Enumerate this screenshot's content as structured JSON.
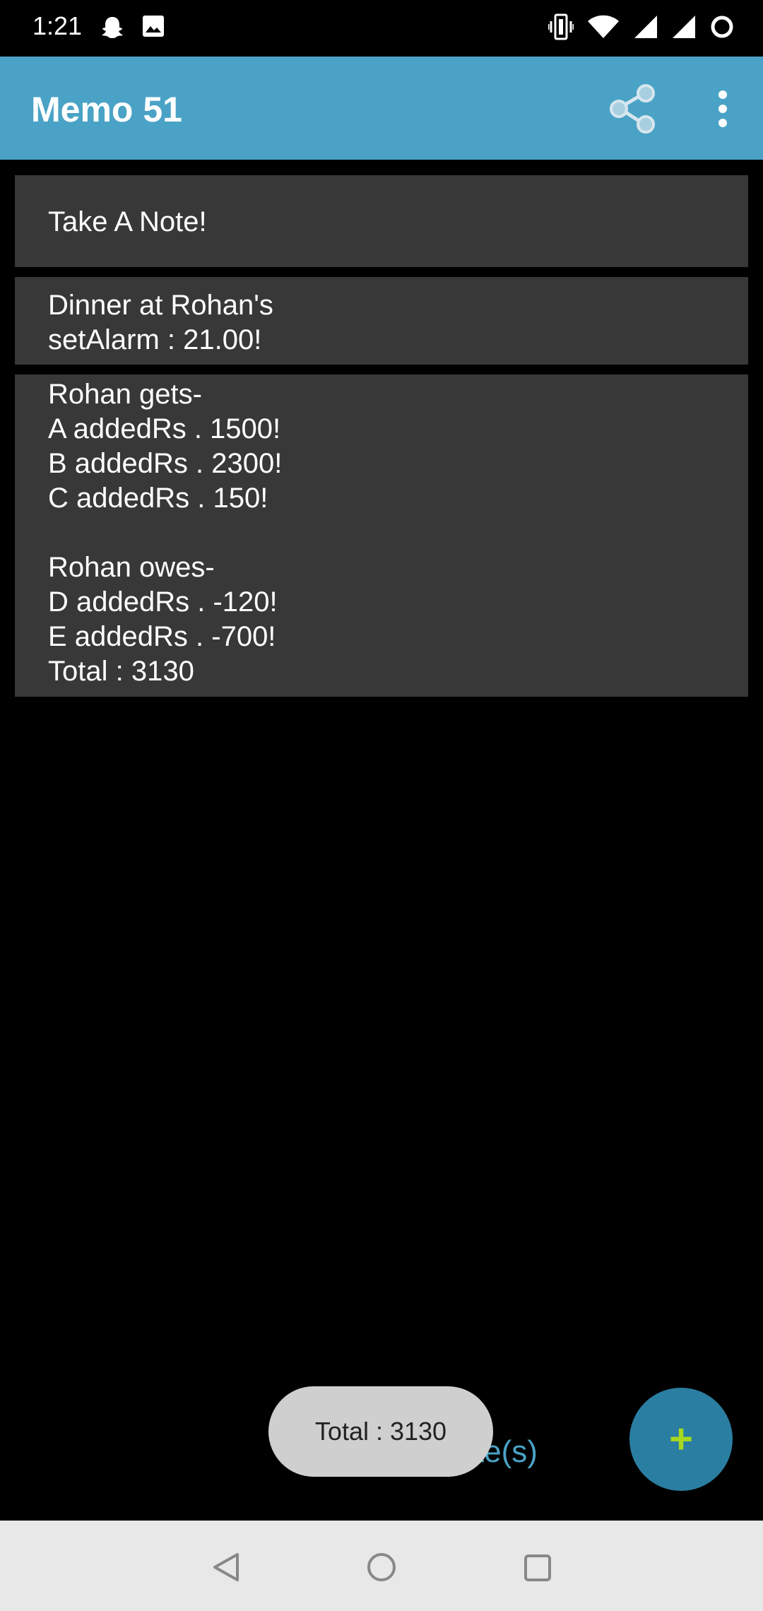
{
  "status_bar": {
    "time": "1:21",
    "left_icons": [
      "snapchat-icon",
      "image-icon"
    ],
    "right_icons": [
      "vibrate-icon",
      "wifi-icon",
      "signal-icon",
      "signal-icon",
      "circle-icon"
    ]
  },
  "app_bar": {
    "title": "Memo 51",
    "actions": [
      "share-icon",
      "more-vert-icon"
    ],
    "color": "#4aa3c6"
  },
  "notes": [
    {
      "text": "Take A Note!"
    },
    {
      "text": "Dinner at Rohan's\nsetAlarm : 21.00!"
    },
    {
      "text": "Rohan gets-\nA addedRs . 1500!\nB addedRs . 2300!\nC addedRs . 150!\n\nRohan owes-\nD addedRs . -120!\nE addedRs . -700!\nTotal : 3130"
    }
  ],
  "footer": {
    "count_label": "3 Note(s)",
    "toast": "Total : 3130",
    "fab": {
      "icon": "plus-icon",
      "label": "+"
    }
  },
  "nav_bar": {
    "buttons": [
      "back-icon",
      "home-icon",
      "recents-icon"
    ]
  }
}
